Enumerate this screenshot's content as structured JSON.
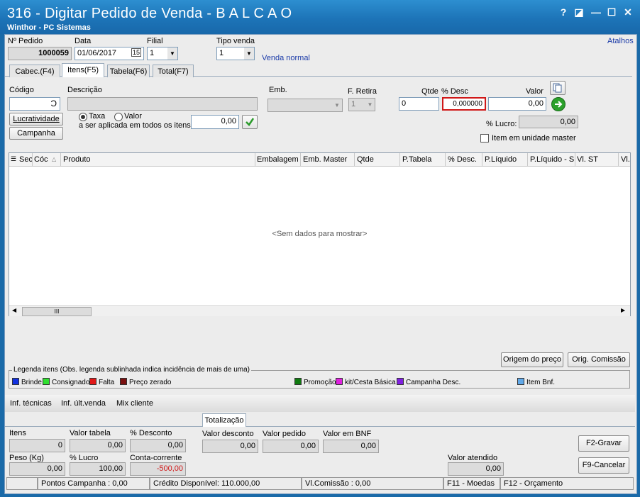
{
  "window": {
    "title": "316 - Digitar Pedido de Venda - B A L C A O",
    "subtitle": "Winthor - PC Sistemas",
    "help": "?",
    "restore": "◪",
    "minimize": "—",
    "maximize": "☐",
    "close": "✕"
  },
  "header": {
    "pedido_label": "Nº Pedido",
    "pedido_value": "1000059",
    "data_label": "Data",
    "data_value": "01/06/2017",
    "filial_label": "Filial",
    "filial_value": "1",
    "tipo_label": "Tipo venda",
    "tipo_value": "1",
    "tipo_desc": "Venda normal",
    "atalhos": "Atalhos"
  },
  "tabs": [
    {
      "label": "Cabec.(F4)"
    },
    {
      "label": "Itens(F5)"
    },
    {
      "label": "Tabela(F6)"
    },
    {
      "label": "Total(F7)"
    }
  ],
  "item_form": {
    "codigo_label": "Código",
    "descricao_label": "Descrição",
    "emb_label": "Emb.",
    "fretira_label": "F. Retira",
    "fretira_value": "1",
    "qtde_label": "Qtde",
    "qtde_value": "0",
    "desc_label": "% Desc",
    "desc_value": "0,000000",
    "valor_label": "Valor",
    "valor_value": "0,00",
    "lucratividade_btn": "Lucratividade",
    "campanha_btn": "Campanha",
    "taxa_label": "Taxa",
    "valor_radio_label": "Valor",
    "aplicada_label": "a ser aplicada em todos os itens:",
    "aplicada_value": "0,00",
    "lucro_label": "% Lucro:",
    "lucro_value": "0,00",
    "master_label": "Item em unidade master"
  },
  "grid": {
    "columns": [
      "Sec",
      "Cóc",
      "Produto",
      "Embalagem",
      "Emb. Master",
      "Qtde",
      "P.Tabela",
      "% Desc.",
      "P.Líquido",
      "P.Líquido - S",
      "Vl. ST",
      "Vl."
    ],
    "empty_text": "<Sem dados para mostrar>"
  },
  "buttons": {
    "origem_preco": "Origem do preço",
    "orig_comissao": "Orig. Comissão",
    "gravar": "F2-Gravar",
    "cancelar": "F9-Cancelar"
  },
  "legend": {
    "title": "Legenda itens (Obs. legenda sublinhada indica incidência de mais de uma)",
    "items": [
      {
        "label": "Brinde",
        "color": "#1030e0"
      },
      {
        "label": "Consignado",
        "color": "#30e030"
      },
      {
        "label": "Falta",
        "color": "#e01818"
      },
      {
        "label": "Preço zerado",
        "color": "#7a1010"
      },
      {
        "label": "Promoção",
        "color": "#107a10"
      },
      {
        "label": "kit/Cesta Básica",
        "color": "#e020e0"
      },
      {
        "label": "Campanha Desc.",
        "color": "#8020e0"
      },
      {
        "label": "Item Bnf.",
        "color": "#60a8e8"
      }
    ]
  },
  "links": {
    "inf_tecnicas": "Inf. técnicas",
    "inf_ult_venda": "Inf. últ.venda",
    "mix_cliente": "Mix cliente"
  },
  "totalizacao": {
    "tab_label": "Totalização",
    "itens_label": "Itens",
    "itens_value": "0",
    "valor_tabela_label": "Valor tabela",
    "valor_tabela_value": "0,00",
    "pct_desconto_label": "% Desconto",
    "pct_desconto_value": "0,00",
    "valor_desconto_label": "Valor desconto",
    "valor_desconto_value": "0,00",
    "valor_pedido_label": "Valor pedido",
    "valor_pedido_value": "0,00",
    "valor_bnf_label": "Valor em BNF",
    "valor_bnf_value": "0,00",
    "peso_label": "Peso (Kg)",
    "peso_value": "0,00",
    "pct_lucro_label": "% Lucro",
    "pct_lucro_value": "100,00",
    "conta_corrente_label": "Conta-corrente",
    "conta_corrente_value": "-500,00",
    "valor_atendido_label": "Valor atendido",
    "valor_atendido_value": "0,00"
  },
  "status": {
    "pontos": "Pontos Campanha : 0,00",
    "credito": "Crédito Disponível: 110.000,00",
    "comissao": "Vl.Comissão : 0,00",
    "moedas": "F11 - Moedas",
    "orcamento": "F12 - Orçamento"
  }
}
